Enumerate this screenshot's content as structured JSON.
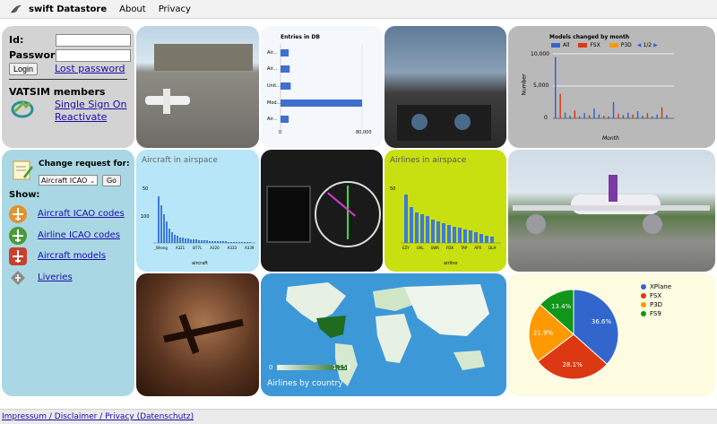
{
  "nav": {
    "brand": "swift Datastore",
    "about": "About",
    "privacy": "Privacy"
  },
  "login": {
    "id_label": "Id:",
    "password_label": "Password:",
    "login_button": "Login",
    "lost_password": "Lost password",
    "vatsim_title": "VATSIM members",
    "single_sign_on": "Single Sign On",
    "reactivate": "Reactivate"
  },
  "change_request": {
    "title": "Change request for:",
    "select_value": "Aircraft ICAO",
    "go_button": "Go",
    "show_label": "Show:",
    "links": [
      "Aircraft ICAO codes",
      "Airline ICAO codes",
      "Aircraft models",
      "Liveries"
    ]
  },
  "entries_chart": {
    "title": "Entries in DB",
    "categories": [
      "Air...",
      "Air...",
      "Unit...",
      "Mod...",
      "Air..."
    ],
    "ticks": [
      "0",
      "80,000"
    ]
  },
  "models_chart": {
    "title": "Models changed by month",
    "legend": [
      "All",
      "FSX",
      "P3D"
    ],
    "pager": "1/2",
    "yticks": [
      "10,000",
      "5,000",
      "0"
    ],
    "ylabel": "Number",
    "xlabel": "Month"
  },
  "aircraft_airspace": {
    "title": "Aircraft in airspace",
    "yticks": [
      "50",
      "100"
    ],
    "xlabels": [
      "_Wrong",
      "A321",
      "B77L",
      "A320",
      "A333",
      "A339"
    ],
    "axis_label": "aircraft"
  },
  "airlines_airspace": {
    "title": "Airlines in airspace",
    "yticks": [
      "50"
    ],
    "xlabels": [
      "EZY",
      "UAL",
      "SWR",
      "FDX",
      "TAP",
      "AFR",
      "DLH"
    ],
    "axis_label": "airline"
  },
  "map": {
    "min": "0",
    "max": "1,154",
    "caption": "Airlines by country"
  },
  "pie": {
    "legend": [
      "XPlane",
      "FSX",
      "P3D",
      "FS9"
    ],
    "labels": [
      "36.6%",
      "28.1%",
      "21.9%",
      "13.4%"
    ]
  },
  "footer": {
    "text": "Impressum / Disclaimer / Privacy (Datenschutz)"
  },
  "chart_data": [
    {
      "type": "bar",
      "title": "Entries in DB",
      "categories": [
        "Air...",
        "Air...",
        "Unit...",
        "Mod...",
        "Air..."
      ],
      "values": [
        8000,
        9000,
        10000,
        80000,
        8000
      ],
      "xlim": [
        0,
        80000
      ]
    },
    {
      "type": "pie",
      "categories": [
        "XPlane",
        "FSX",
        "P3D",
        "FS9"
      ],
      "values": [
        36.6,
        28.1,
        21.9,
        13.4
      ],
      "colors": [
        "#3366cc",
        "#dc3912",
        "#ff9900",
        "#109618"
      ]
    }
  ]
}
